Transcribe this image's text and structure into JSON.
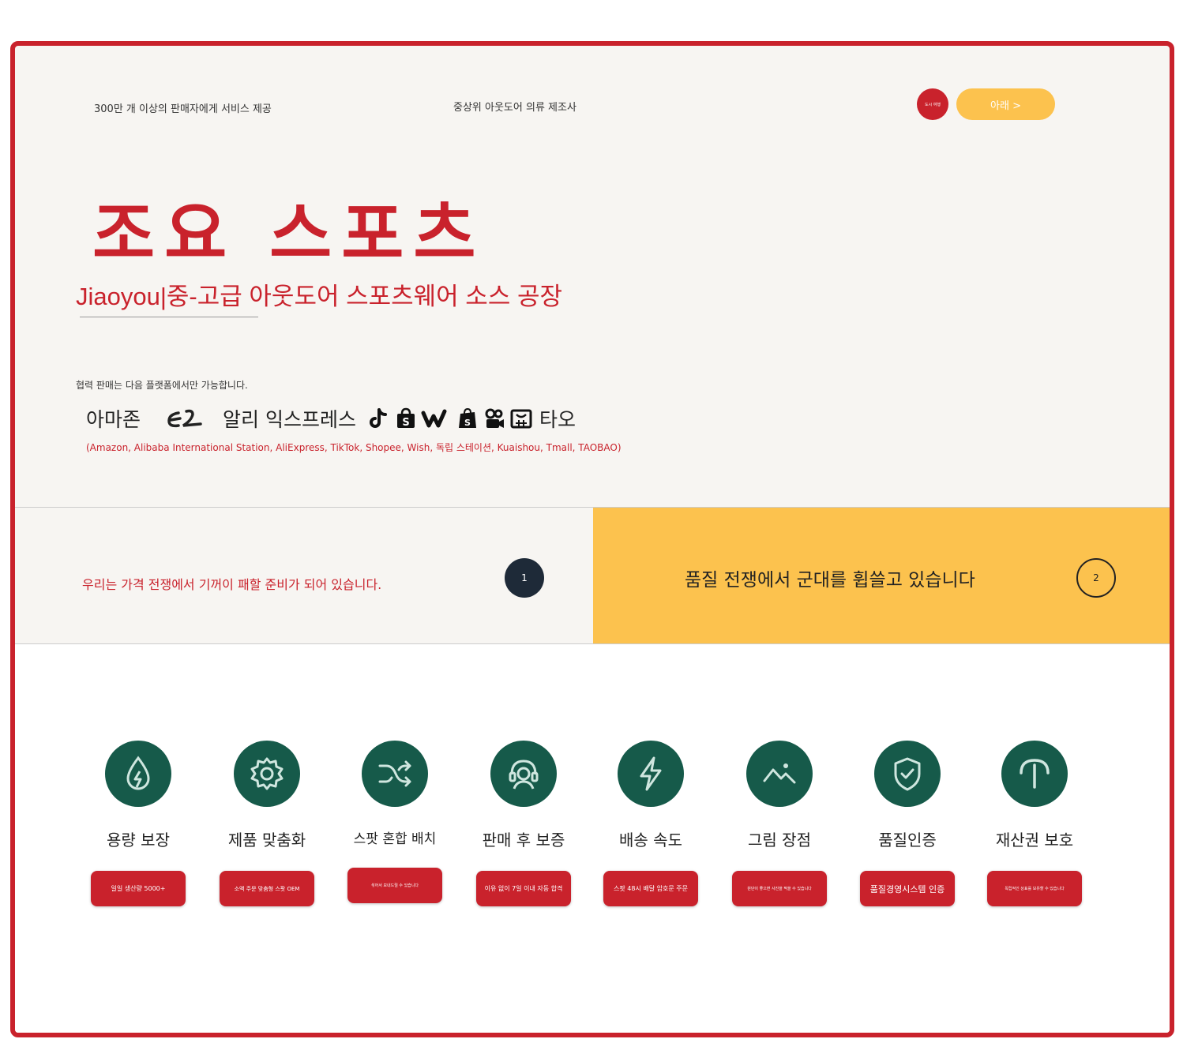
{
  "topbar": {
    "sellers_text": "300만 개 이상의 판매자에게 서비스 제공",
    "manufacturer_text": "중상위 아웃도어 의류 제조사",
    "badge_text": "도시 여행",
    "down_button": "아래 >"
  },
  "hero": {
    "title": "조요 스포츠",
    "subtitle": "Jiaoyou|중-고급 아웃도어 스포츠웨어 소스 공장"
  },
  "platforms": {
    "note": "협력 판매는 다음 플랫폼에서만 가능합니다.",
    "amazon": "아마존",
    "aliexpress": "알리 익스프레스",
    "taobao": "타오",
    "list": "(Amazon, Alibaba International Station, AliExpress, TikTok, Shopee, Wish, 독립 스테이션, Kuaishou, Tmall, TAOBAO)",
    "icons": [
      "alibaba-icon",
      "tiktok-icon",
      "shopee-icon",
      "wish-icon",
      "shopify-icon",
      "kuaishou-icon",
      "tmall-icon"
    ]
  },
  "band": {
    "left_text": "우리는 가격 전쟁에서 기꺼이 패할 준비가 되어 있습니다.",
    "left_number": "1",
    "right_text": "품질 전쟁에서 군대를 휩쓸고 있습니다",
    "right_number": "2"
  },
  "features": [
    {
      "icon": "water-drop-icon",
      "label": "용량 보장",
      "button": "일일 생산량 5000+"
    },
    {
      "icon": "gear-icon",
      "label": "제품 맞춤화",
      "button": "소액 주문 맞춤형 스팟 OEM"
    },
    {
      "icon": "shuffle-icon",
      "label": "스팟 혼합 배치",
      "button": "섞어서 보내드릴 수 있습니다"
    },
    {
      "icon": "headset-icon",
      "label": "판매 후 보증",
      "button": "이유 없이 7일 이내 자동 합격"
    },
    {
      "icon": "lightning-icon",
      "label": "배송 속도",
      "button": "스팟 48시 배달 암호문 주문"
    },
    {
      "icon": "image-icon",
      "label": "그림 장점",
      "button": "원단이 좋으면 사진을 찍을 수 있습니다"
    },
    {
      "icon": "shield-check-icon",
      "label": "품질인증",
      "button": "품질경영시스템 인증"
    },
    {
      "icon": "umbrella-icon",
      "label": "재산권 보호",
      "button": "독립적인 상표를 보유할 수 있습니다"
    }
  ],
  "colors": {
    "brand_red": "#c9222c",
    "accent_yellow": "#fcc24e",
    "icon_green": "#165a4a",
    "dark_circle": "#1e2a38"
  }
}
